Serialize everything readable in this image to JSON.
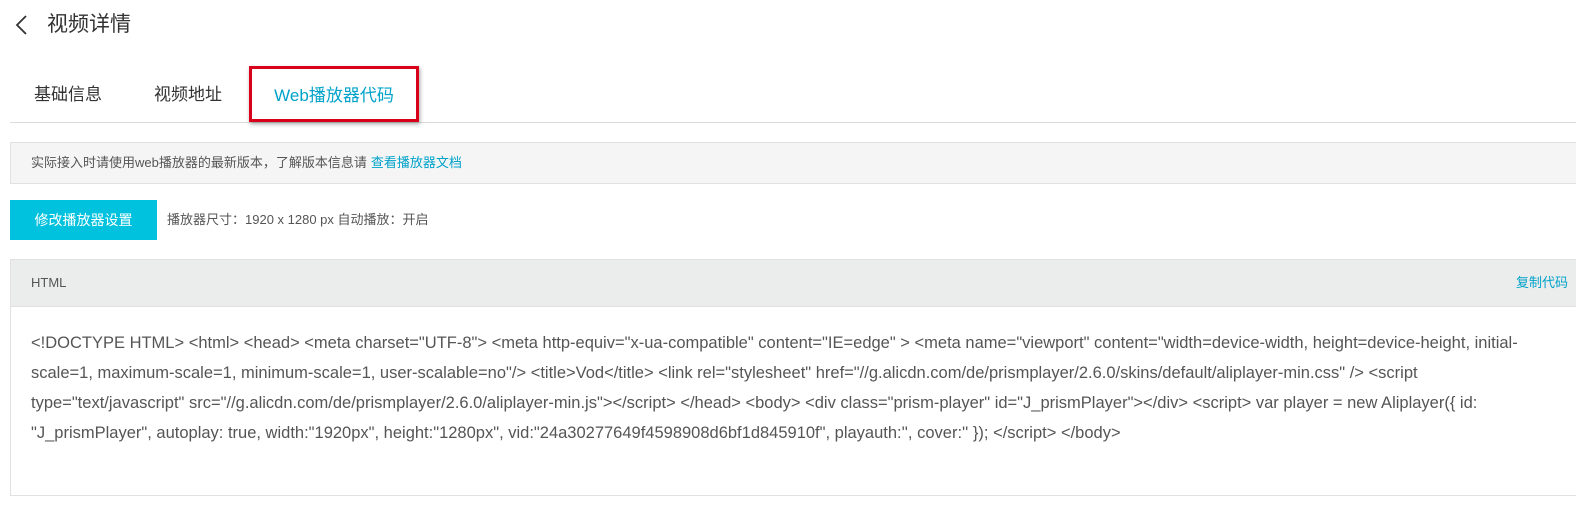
{
  "header": {
    "back_icon": "chevron-left-icon",
    "title": "视频详情"
  },
  "tabs": [
    {
      "label": "基础信息",
      "active": false
    },
    {
      "label": "视频地址",
      "active": false
    },
    {
      "label": "Web播放器代码",
      "active": true
    }
  ],
  "notice": {
    "text": "实际接入时请使用web播放器的最新版本，了解版本信息请",
    "link": "查看播放器文档"
  },
  "settings": {
    "button_label": "修改播放器设置",
    "info": "播放器尺寸：1920 x 1280 px 自动播放：开启"
  },
  "code_panel": {
    "label": "HTML",
    "copy_label": "复制代码",
    "code": "<!DOCTYPE HTML> <html> <head> <meta charset=\"UTF-8\"> <meta http-equiv=\"x-ua-compatible\" content=\"IE=edge\" > <meta name=\"viewport\" content=\"width=device-width, height=device-height, initial-scale=1, maximum-scale=1, minimum-scale=1, user-scalable=no\"/> <title>Vod</title> <link rel=\"stylesheet\" href=\"//g.alicdn.com/de/prismplayer/2.6.0/skins/default/aliplayer-min.css\" /> <script type=\"text/javascript\" src=\"//g.alicdn.com/de/prismplayer/2.6.0/aliplayer-min.js\"></script> </head> <body> <div class=\"prism-player\" id=\"J_prismPlayer\"></div> <script> var player = new Aliplayer({ id: \"J_prismPlayer\", autoplay: true, width:\"1920px\", height:\"1280px\", vid:\"24a30277649f4598908d6bf1d845910f\", playauth:'', cover:'' }); </script> </body>"
  },
  "colors": {
    "accent": "#00a2ca",
    "primary_button": "#00c1de",
    "highlight_border": "#d9001b"
  }
}
